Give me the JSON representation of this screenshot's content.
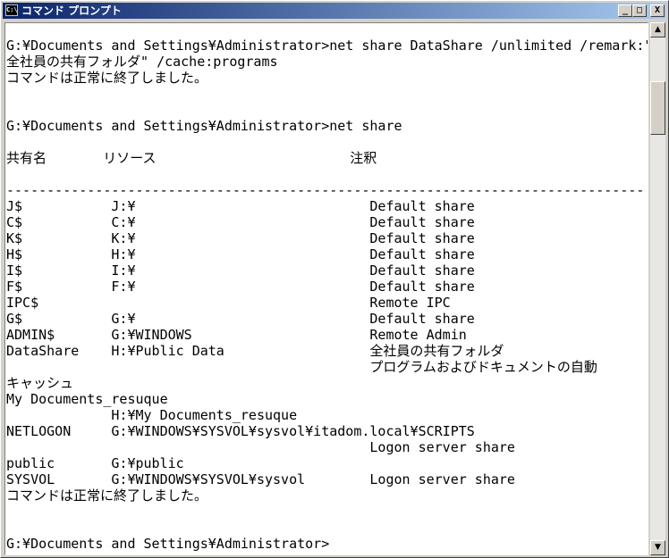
{
  "window": {
    "title": "コマンド プロンプト",
    "icon_text": "C:\\",
    "minimize_glyph": "_",
    "maximize_glyph": "□",
    "close_glyph": "X"
  },
  "console": {
    "lines": [
      "G:¥Documents and Settings¥Administrator>net share DataShare /unlimited /remark:\"",
      "全社員の共有フォルダ\" /cache:programs",
      "コマンドは正常に終了しました。",
      "",
      "",
      "G:¥Documents and Settings¥Administrator>net share",
      "",
      "共有名       リソース                        注釈",
      "",
      "-------------------------------------------------------------------------------",
      "J$           J:¥                             Default share",
      "C$           C:¥                             Default share",
      "K$           K:¥                             Default share",
      "H$           H:¥                             Default share",
      "I$           I:¥                             Default share",
      "F$           F:¥                             Default share",
      "IPC$                                         Remote IPC",
      "G$           G:¥                             Default share",
      "ADMIN$       G:¥WINDOWS                      Remote Admin",
      "DataShare    H:¥Public Data                  全社員の共有フォルダ",
      "                                             プログラムおよびドキュメントの自動",
      "キャッシュ",
      "My Documents_resuque",
      "             H:¥My Documents_resuque",
      "NETLOGON     G:¥WINDOWS¥SYSVOL¥sysvol¥itadom.local¥SCRIPTS",
      "                                             Logon server share",
      "public       G:¥public",
      "SYSVOL       G:¥WINDOWS¥SYSVOL¥sysvol        Logon server share",
      "コマンドは正常に終了しました。",
      "",
      "",
      "G:¥Documents and Settings¥Administrator>"
    ]
  },
  "scrollbar": {
    "up_glyph": "▲",
    "down_glyph": "▼"
  }
}
